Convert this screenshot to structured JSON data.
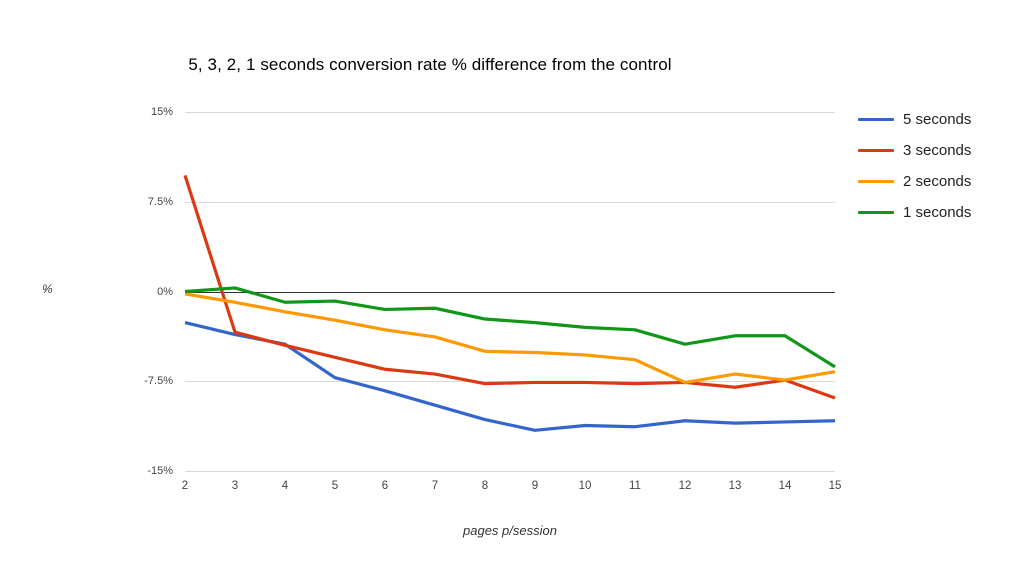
{
  "chart_data": {
    "type": "line",
    "title": "5, 3, 2, 1 seconds conversion rate % difference from the control",
    "xlabel": "pages p/session",
    "ylabel": "%",
    "x": [
      2,
      3,
      4,
      5,
      6,
      7,
      8,
      9,
      10,
      11,
      12,
      13,
      14,
      15
    ],
    "categories": [
      "2",
      "3",
      "4",
      "5",
      "6",
      "7",
      "8",
      "9",
      "10",
      "11",
      "12",
      "13",
      "14",
      "15"
    ],
    "ylim": [
      -15,
      15
    ],
    "yticks": [
      15,
      7.5,
      0,
      -7.5,
      -15
    ],
    "ytick_labels": [
      "15%",
      "7.5%",
      "0%",
      "-7.5%",
      "-15%"
    ],
    "grid": true,
    "legend_position": "right",
    "series": [
      {
        "name": "5 seconds",
        "color": "#3366cc",
        "values": [
          -2.6,
          -3.6,
          -4.4,
          -7.2,
          -8.3,
          -9.5,
          -10.7,
          -11.6,
          -11.2,
          -11.3,
          -10.8,
          -11.0,
          -10.9,
          -10.8
        ]
      },
      {
        "name": "3 seconds",
        "color": "#dc3912",
        "values": [
          9.7,
          -3.4,
          -4.5,
          -5.5,
          -6.5,
          -6.9,
          -7.7,
          -7.6,
          -7.6,
          -7.7,
          -7.6,
          -8.0,
          -7.4,
          -8.9
        ]
      },
      {
        "name": "2 seconds",
        "color": "#ff9900",
        "values": [
          -0.2,
          -0.9,
          -1.7,
          -2.4,
          -3.2,
          -3.8,
          -5.0,
          -5.1,
          -5.3,
          -5.7,
          -7.6,
          -6.9,
          -7.4,
          -6.7
        ]
      },
      {
        "name": "1 seconds",
        "color": "#109618",
        "values": [
          0.0,
          0.3,
          -0.9,
          -0.8,
          -1.5,
          -1.4,
          -2.3,
          -2.6,
          -3.0,
          -3.2,
          -4.4,
          -3.7,
          -3.7,
          -6.3
        ]
      }
    ]
  },
  "legend": {
    "items": [
      {
        "label": "5 seconds",
        "color": "#3366cc"
      },
      {
        "label": "3 seconds",
        "color": "#dc3912"
      },
      {
        "label": "2 seconds",
        "color": "#ff9900"
      },
      {
        "label": "1 seconds",
        "color": "#109618"
      }
    ]
  }
}
